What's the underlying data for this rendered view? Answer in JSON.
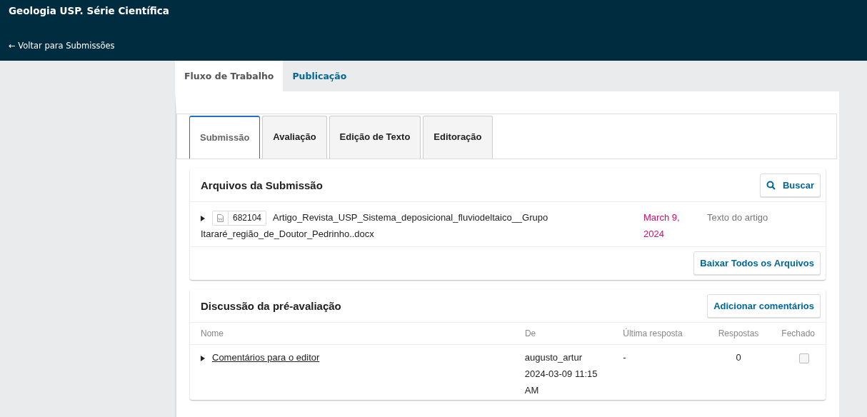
{
  "header": {
    "title": "Geologia USP. Série Científica",
    "back_link": "← Voltar para Submissões"
  },
  "page_tabs": [
    {
      "label": "Fluxo de Trabalho",
      "selected": true
    },
    {
      "label": "Publicação",
      "selected": false
    }
  ],
  "stage_tabs": [
    {
      "label": "Submissão",
      "selected": true
    },
    {
      "label": "Avaliação",
      "selected": false
    },
    {
      "label": "Edição de Texto",
      "selected": false
    },
    {
      "label": "Editoração",
      "selected": false
    }
  ],
  "files_panel": {
    "title": "Arquivos da Submissão",
    "search_button": "Buscar",
    "files": [
      {
        "id": "682104",
        "name_lines": [
          "Artigo_Revista_USP_Sistema_deposicional_fluviodeltaico__Grupo",
          "Itararé_região_de_Doutor_Pedrinho..docx"
        ],
        "date": "March 9, 2024",
        "type": "Texto do artigo"
      }
    ],
    "download_button": "Baixar Todos os Arquivos"
  },
  "discussion_panel": {
    "title": "Discussão da pré-avaliação",
    "add_button": "Adicionar comentários",
    "columns": [
      "Nome",
      "De",
      "Última resposta",
      "Respostas",
      "Fechado"
    ],
    "rows": [
      {
        "name": "Comentários para o editor",
        "from": "augusto_artur 2024-03-09 11:15 AM",
        "last_reply": "-",
        "replies": "0",
        "closed": false
      }
    ]
  }
}
